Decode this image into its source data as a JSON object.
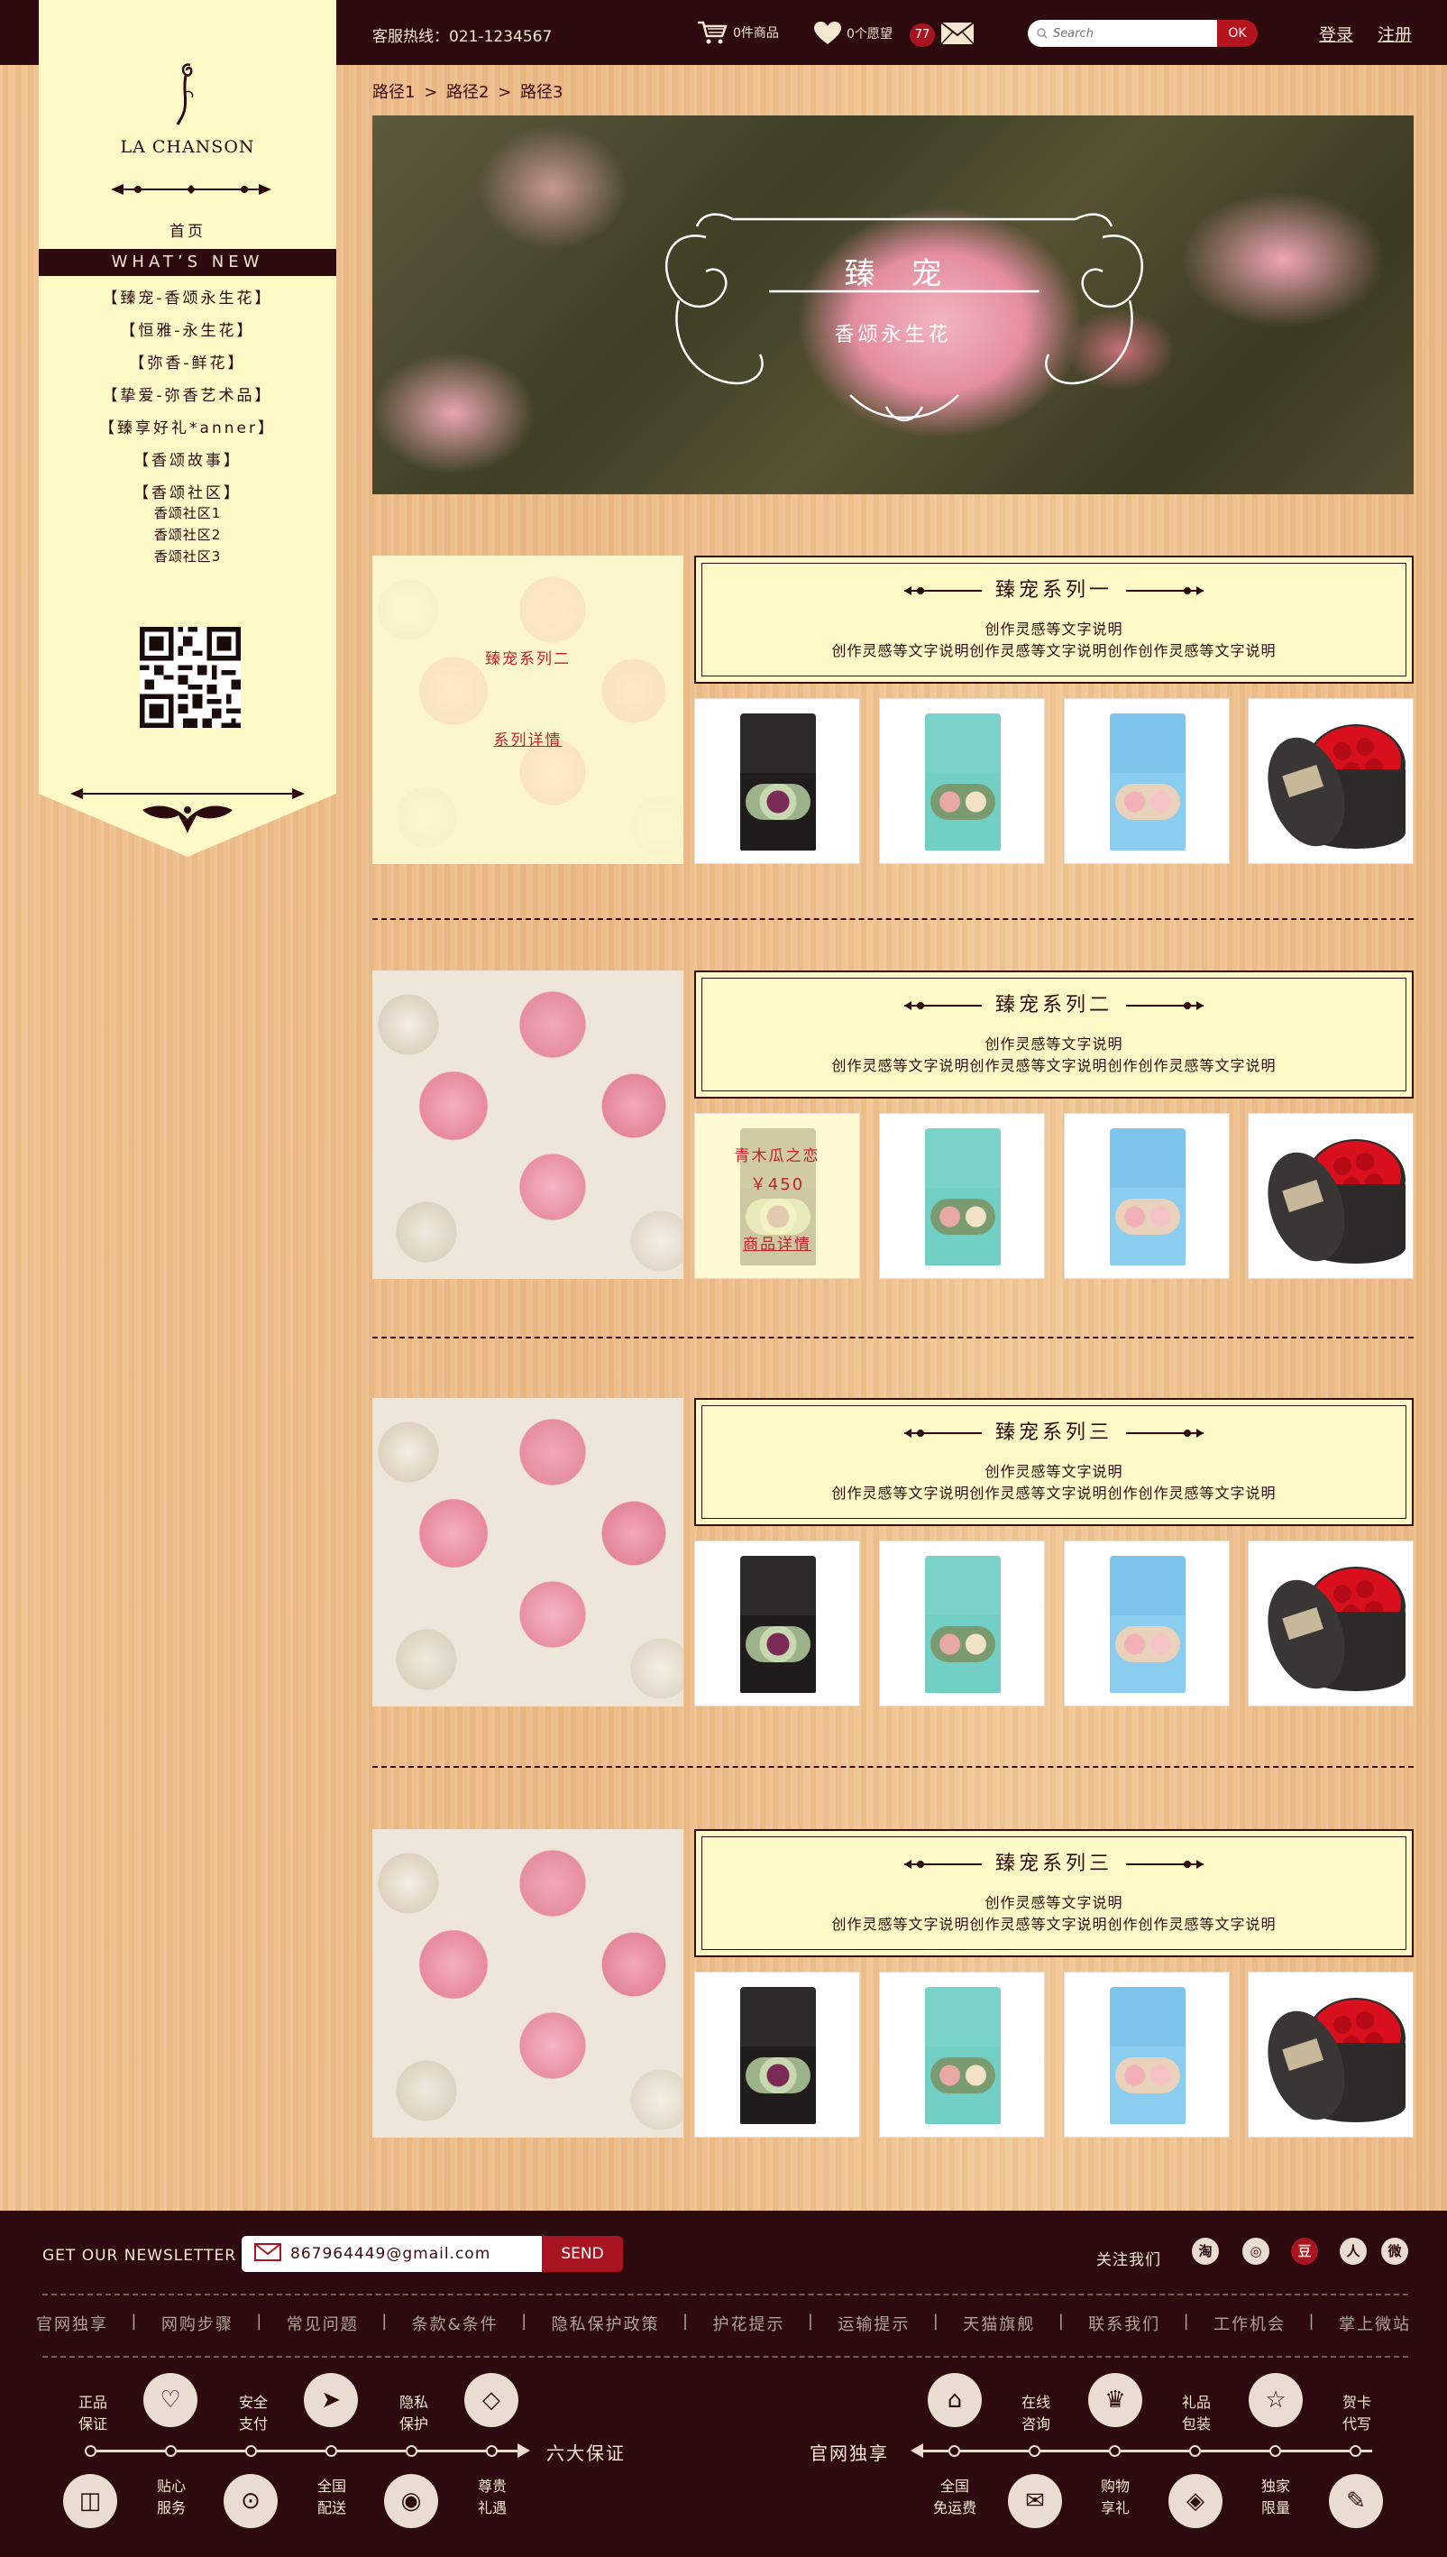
{
  "header": {
    "hotline": "客服热线：021-1234567",
    "cart_text": "0件商品",
    "wishlist_text": "0个愿望",
    "message_count": "77",
    "search_placeholder": "Search",
    "search_button": "OK",
    "login": "登录",
    "register": "注册"
  },
  "sidebar": {
    "brand": "LA CHANSON",
    "home": "首页",
    "active": "WHAT’S NEW",
    "items": [
      "【臻宠-香颂永生花】",
      "【恒雅-永生花】",
      "【弥香-鲜花】",
      "【挚爱-弥香艺术品】",
      "【臻享好礼*anner】",
      "【香颂故事】",
      "【香颂社区】"
    ],
    "sub_items": [
      "香颂社区1",
      "香颂社区2",
      "香颂社区3"
    ]
  },
  "breadcrumb": [
    "路径1",
    "路径2",
    "路径3"
  ],
  "breadcrumb_sep": ">",
  "hero": {
    "title": "臻宠",
    "subtitle": "香颂永生花"
  },
  "sections": [
    {
      "title": "臻宠系列一",
      "line1": "创作灵感等文字说明",
      "line2": "创作灵感等文字说明创作灵感等文字说明创作创作灵感等文字说明",
      "overlay_title": "臻宠系列二",
      "overlay_link": "系列详情"
    },
    {
      "title": "臻宠系列二",
      "line1": "创作灵感等文字说明",
      "line2": "创作灵感等文字说明创作灵感等文字说明创作创作灵感等文字说明",
      "hover_product": {
        "name": "青木瓜之恋",
        "price": "￥450",
        "link": "商品详情"
      }
    },
    {
      "title": "臻宠系列三",
      "line1": "创作灵感等文字说明",
      "line2": "创作灵感等文字说明创作灵感等文字说明创作创作灵感等文字说明"
    },
    {
      "title": "臻宠系列三",
      "line1": "创作灵感等文字说明",
      "line2": "创作灵感等文字说明创作灵感等文字说明创作创作灵感等文字说明"
    }
  ],
  "product_boxes": [
    {
      "icon": "black-flower-box",
      "lid": "#2d2a28",
      "body": "#1f1c1b",
      "flowers": "#7b2a56"
    },
    {
      "icon": "teal-flower-box",
      "lid": "#79d3c9",
      "body": "#71cfc3",
      "flowers": "#e6a9a6"
    },
    {
      "icon": "blue-flower-box",
      "lid": "#7cc4ea",
      "body": "#8acdef",
      "flowers": "#f1b1b6"
    },
    {
      "icon": "round-rose-box",
      "lid": "#3a3636",
      "body": "#2e2a2a",
      "flowers": "#d8101d"
    }
  ],
  "footer": {
    "newsletter_label": "GET OUR NEWSLETTER",
    "newsletter_email": "867964449@gmail.com",
    "send": "SEND",
    "follow": "关注我们",
    "social_icons": [
      "taobao-icon",
      "weibo-icon",
      "douban-icon",
      "renren-icon",
      "wechat-icon"
    ],
    "social_glyphs": [
      "淘",
      "◎",
      "豆",
      "人",
      "微"
    ],
    "links": [
      "官网独享",
      "网购步骤",
      "常见问题",
      "条款&条件",
      "隐私保护政策",
      "护花提示",
      "运输提示",
      "天猫旗舰",
      "联系我们",
      "工作机会",
      "掌上微站"
    ],
    "link_sep": "|",
    "six_guarantees": "六大保证",
    "exclusive": "官网独享",
    "left_top": [
      "正品\n保证",
      "安全\n支付",
      "隐私\n保护"
    ],
    "left_bottom": [
      "贴心\n服务",
      "全国\n配送",
      "尊贵\n礼遇"
    ],
    "right_top": [
      "在线\n咨询",
      "礼品\n包装",
      "贺卡\n代写"
    ],
    "right_bottom": [
      "全国\n免运费",
      "购物\n享礼",
      "独家\n限量"
    ],
    "left_top_icons": [
      "heart-icon",
      "paper-plane-icon",
      "diamond-icon"
    ],
    "left_bottom_icons": [
      "shopping-bag-icon",
      "lock-icon",
      "eye-icon"
    ],
    "right_top_icons": [
      "cart-icon",
      "crown-icon",
      "star-icon"
    ],
    "right_bottom_icons": [
      "chat-icon",
      "gift-box-icon",
      "pen-icon"
    ],
    "left_top_glyphs": [
      "♡",
      "➤",
      "◇"
    ],
    "left_bottom_glyphs": [
      "◫",
      "⊙",
      "◉"
    ],
    "right_top_glyphs": [
      "⌂",
      "♛",
      "☆"
    ],
    "right_bottom_glyphs": [
      "✉",
      "◈",
      "✎"
    ]
  },
  "colors": {
    "dark": "#2c0a0d",
    "cream": "#fff9c7",
    "accent_red": "#a8141f",
    "wood": "#eebc86"
  }
}
